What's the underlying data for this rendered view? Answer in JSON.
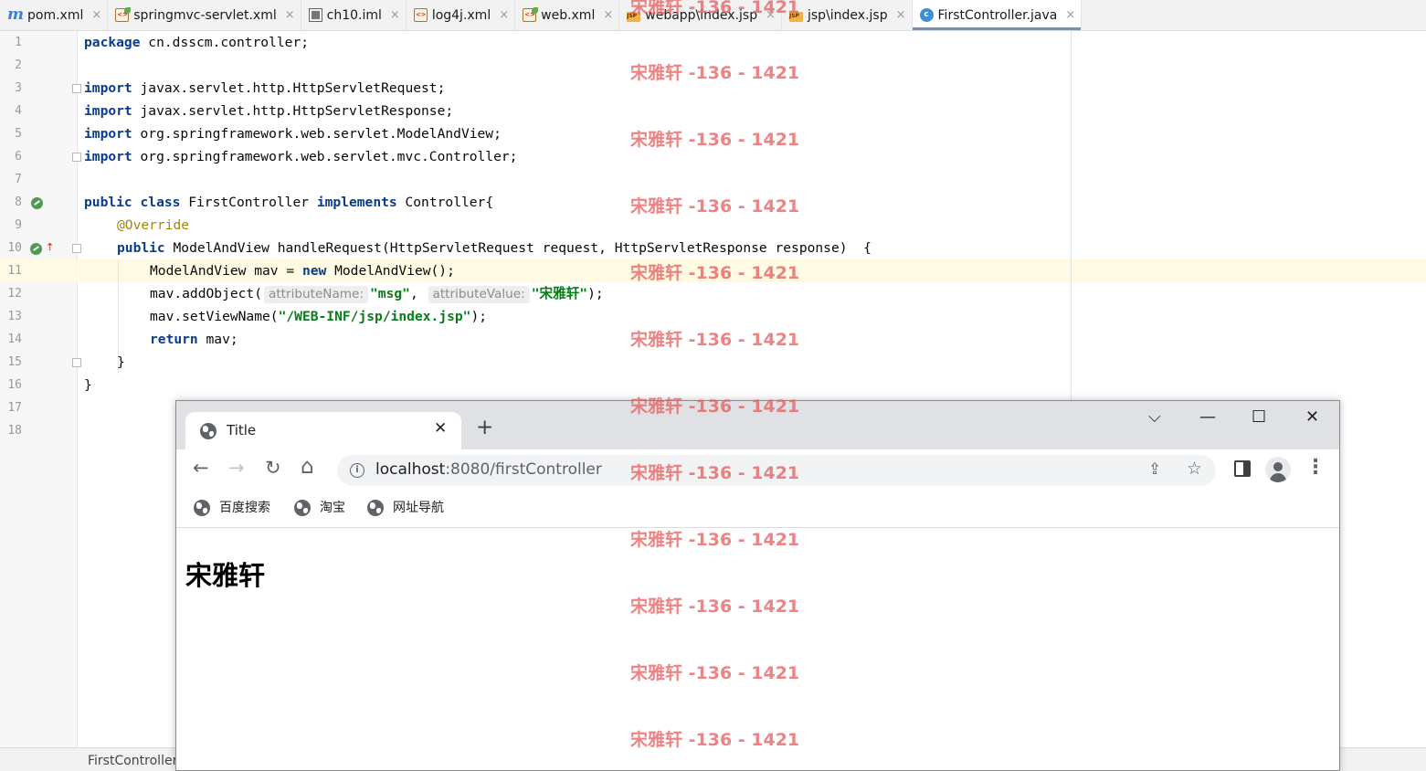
{
  "editor_tabs": [
    {
      "label": "pom.xml",
      "icon": "maven-icon"
    },
    {
      "label": "springmvc-servlet.xml",
      "icon": "spring-xml-icon"
    },
    {
      "label": "ch10.iml",
      "icon": "module-file-icon"
    },
    {
      "label": "log4j.xml",
      "icon": "xml-file-icon"
    },
    {
      "label": "web.xml",
      "icon": "xml-file-icon"
    },
    {
      "label": "webapp\\index.jsp",
      "icon": "jsp-file-icon"
    },
    {
      "label": "jsp\\index.jsp",
      "icon": "jsp-file-icon"
    },
    {
      "label": "FirstController.java",
      "icon": "java-class-icon",
      "active": true
    }
  ],
  "tab_close_glyph": "×",
  "line_numbers": [
    "1",
    "2",
    "3",
    "4",
    "5",
    "6",
    "7",
    "8",
    "9",
    "10",
    "11",
    "12",
    "13",
    "14",
    "15",
    "16",
    "17",
    "18"
  ],
  "code": {
    "l1": {
      "kw": "package",
      "rest": " cn.dsscm.controller;"
    },
    "import_kw": "import",
    "l3": " javax.servlet.http.HttpServletRequest;",
    "l4": " javax.servlet.http.HttpServletResponse;",
    "l5": " org.springframework.web.servlet.ModelAndView;",
    "l6": " org.springframework.web.servlet.mvc.Controller;",
    "l8": {
      "kw1": "public class",
      "mid": " FirstController ",
      "kw2": "implements",
      "rest": " Controller{"
    },
    "l9": "@Override",
    "l10": {
      "kw": "public",
      "rest": " ModelAndView handleRequest(HttpServletRequest request, HttpServletResponse response)  {"
    },
    "l11": {
      "a": "ModelAndView mav = ",
      "kw": "new",
      "b": " ModelAndView();"
    },
    "l12": {
      "a": "mav.addObject(",
      "hint1": "attributeName:",
      "s1": "\"msg\"",
      "sep": ", ",
      "hint2": "attributeValue:",
      "s2": "\"宋雅轩\"",
      "b": ");"
    },
    "l13": {
      "a": "mav.setViewName(",
      "s": "\"/WEB-INF/jsp/index.jsp\"",
      "b": ");"
    },
    "l14": {
      "kw": "return",
      "rest": " mav;"
    },
    "l15": "}",
    "l16": "}"
  },
  "statusbar": {
    "breadcrumb": "FirstController"
  },
  "browser": {
    "tab_title": "Title",
    "tab_close": "✕",
    "new_tab": "+",
    "window_controls": {
      "tab_search": "⌵",
      "minimize": "—",
      "maximize": "☐",
      "close": "✕"
    },
    "nav": {
      "back": "←",
      "forward": "→",
      "reload": "↻",
      "home": "⌂"
    },
    "url_host": "localhost",
    "url_rest": ":8080/firstController",
    "info_glyph": "i",
    "share_glyph": "⇪",
    "star_glyph": "☆",
    "menu_glyph": "⋮",
    "bookmarks": [
      "百度搜索",
      "淘宝",
      "网址导航"
    ],
    "page_heading": "宋雅轩"
  },
  "watermark": "宋雅轩 -136 - 1421",
  "colors": {
    "keyword": "#0a3c8c",
    "string": "#067d17",
    "annotation": "#9e880d",
    "caret_line": "#fffae3",
    "watermark": "#e86060"
  }
}
